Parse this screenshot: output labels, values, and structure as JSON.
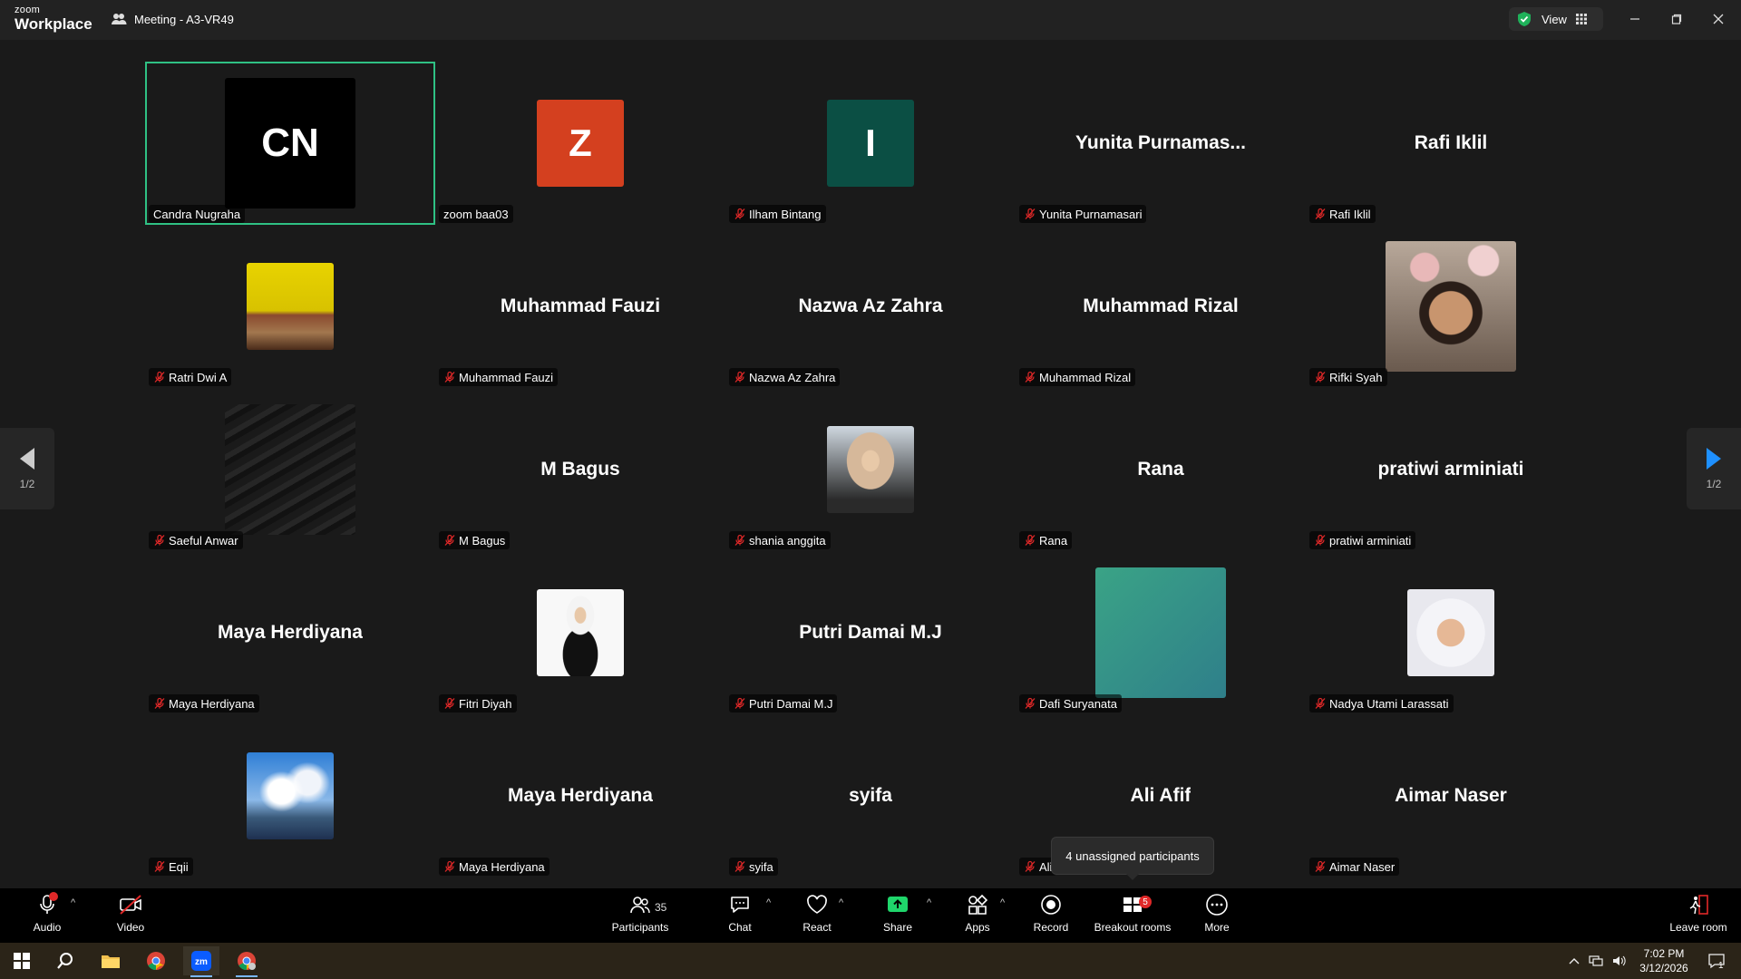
{
  "app": {
    "logo_small": "zoom",
    "logo_big": "Workplace",
    "meeting_title": "Meeting - A3-VR49",
    "view_label": "View"
  },
  "colors": {
    "active_border": "#2fc184",
    "brand_blue": "#0b5cff",
    "accent_teal": "#2fc184"
  },
  "pages": {
    "left_label": "1/2",
    "right_label": "1/2"
  },
  "tiles": [
    {
      "name": "Candra Nugraha",
      "display": "avatar",
      "avatar_text": "CN",
      "avatar_color": "#000000",
      "muted": false,
      "active": true
    },
    {
      "name": "zoom baa03",
      "display": "avatar",
      "avatar_text": "Z",
      "avatar_color": "#d4401f",
      "muted": false
    },
    {
      "name": "Ilham Bintang",
      "display": "avatar",
      "avatar_text": "I",
      "avatar_color": "#0b4f44",
      "muted": true
    },
    {
      "name": "Yunita Purnamasari",
      "display": "name",
      "big_name": "Yunita  Purnamas...",
      "muted": true
    },
    {
      "name": "Rafi Iklil",
      "display": "name",
      "big_name": "Rafi Iklil",
      "muted": true
    },
    {
      "name": "Ratri Dwi A",
      "display": "photo",
      "photo": "cat",
      "muted": true
    },
    {
      "name": "Muhammad Fauzi",
      "display": "name",
      "big_name": "Muhammad Fauzi",
      "muted": true
    },
    {
      "name": "Nazwa Az Zahra",
      "display": "name",
      "big_name": "Nazwa Az Zahra",
      "muted": true
    },
    {
      "name": "Muhammad Rizal",
      "display": "name",
      "big_name": "Muhammad Rizal",
      "muted": true
    },
    {
      "name": "Rifki Syah",
      "display": "photo",
      "photo": "man",
      "muted": true
    },
    {
      "name": "Saeful Anwar",
      "display": "photo",
      "photo": "dark",
      "muted": true
    },
    {
      "name": "M Bagus",
      "display": "name",
      "big_name": "M Bagus",
      "muted": true
    },
    {
      "name": "shania anggita",
      "display": "photo",
      "photo": "hijab-flower",
      "muted": true
    },
    {
      "name": "Rana",
      "display": "name",
      "big_name": "Rana",
      "muted": true
    },
    {
      "name": "pratiwi arminiati",
      "display": "name",
      "big_name": "pratiwi arminiati",
      "muted": true
    },
    {
      "name": "Maya Herdiyana",
      "display": "name",
      "big_name": "Maya Herdiyana",
      "muted": true
    },
    {
      "name": "Fitri Diyah",
      "display": "photo",
      "photo": "hijab-white",
      "muted": true
    },
    {
      "name": "Putri Damai M.J",
      "display": "name",
      "big_name": "Putri Damai M.J",
      "muted": true
    },
    {
      "name": "Dafi Suryanata",
      "display": "photo",
      "photo": "teal",
      "muted": true
    },
    {
      "name": "Nadya Utami Larassati",
      "display": "photo",
      "photo": "hijab-smile",
      "muted": true
    },
    {
      "name": "Eqii",
      "display": "photo",
      "photo": "sky",
      "muted": true
    },
    {
      "name": "Maya Herdiyana",
      "display": "name",
      "big_name": "Maya Herdiyana",
      "muted": true
    },
    {
      "name": "syifa",
      "display": "name",
      "big_name": "syifa",
      "muted": true
    },
    {
      "name": "Ali",
      "display": "name",
      "big_name": "Ali Afif",
      "muted": true
    },
    {
      "name": "Aimar Naser",
      "display": "name",
      "big_name": "Aimar Naser",
      "muted": true
    }
  ],
  "tooltip": {
    "text": "4 unassigned participants"
  },
  "toolbar": {
    "audio": "Audio",
    "video": "Video",
    "participants": "Participants",
    "participants_count": "35",
    "chat": "Chat",
    "react": "React",
    "share": "Share",
    "apps": "Apps",
    "record": "Record",
    "breakout": "Breakout rooms",
    "breakout_badge": "5",
    "more": "More",
    "leave": "Leave room"
  },
  "taskbar": {
    "time": "7:02 PM",
    "date": "3/12/2026",
    "notif_count": "1"
  }
}
